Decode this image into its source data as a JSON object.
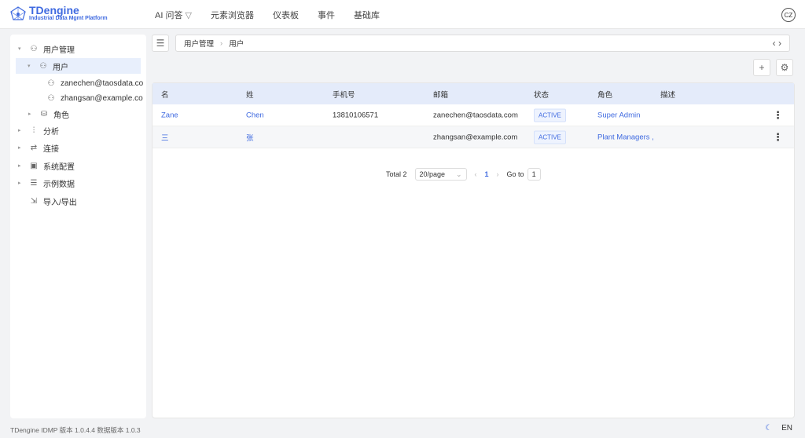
{
  "header": {
    "logo_title": "TDengine",
    "logo_subtitle": "Industrial Data Mgmt Platform",
    "nav": [
      "AI 问答",
      "元素浏览器",
      "仪表板",
      "事件",
      "基础库"
    ],
    "avatar": "CZ"
  },
  "sidebar": {
    "items": [
      {
        "label": "用户管理",
        "icon": "users-icon",
        "arrow": "▾"
      },
      {
        "label": "用户",
        "icon": "user-icon",
        "arrow": "▾"
      },
      {
        "label": "zanechen@taosdata.co",
        "icon": "user-icon",
        "arrow": ""
      },
      {
        "label": "zhangsan@example.co",
        "icon": "user-icon",
        "arrow": ""
      },
      {
        "label": "角色",
        "icon": "role-icon",
        "arrow": "▸"
      },
      {
        "label": "分析",
        "icon": "chart-icon",
        "arrow": "▸"
      },
      {
        "label": "连接",
        "icon": "connect-icon",
        "arrow": "▸"
      },
      {
        "label": "系统配置",
        "icon": "settings-icon",
        "arrow": "▸"
      },
      {
        "label": "示例数据",
        "icon": "database-icon",
        "arrow": "▸"
      },
      {
        "label": "导入/导出",
        "icon": "import-export-icon",
        "arrow": ""
      }
    ]
  },
  "breadcrumb": {
    "items": [
      "用户管理",
      "用户"
    ],
    "sep": "›"
  },
  "table": {
    "columns": [
      "名",
      "姓",
      "手机号",
      "邮箱",
      "状态",
      "角色",
      "描述"
    ],
    "rows": [
      {
        "first": "Zane",
        "last": "Chen",
        "phone": "13810106571",
        "email": "zanechen@taosdata.com",
        "status": "ACTIVE",
        "role": "Super Admin",
        "desc": ""
      },
      {
        "first": "三",
        "last": "张",
        "phone": "",
        "email": "zhangsan@example.com",
        "status": "ACTIVE",
        "role": "Plant Managers ,",
        "desc": ""
      }
    ]
  },
  "pagination": {
    "total": "Total 2",
    "page_size": "20/page",
    "current": "1",
    "goto_label": "Go to",
    "goto_value": "1"
  },
  "footer": {
    "version": "TDengine IDMP 版本 1.0.4.4 数据版本 1.0.3",
    "lang": "EN"
  },
  "colors": {
    "accent": "#3f6ae0",
    "header_bg": "#e4ebfa"
  }
}
